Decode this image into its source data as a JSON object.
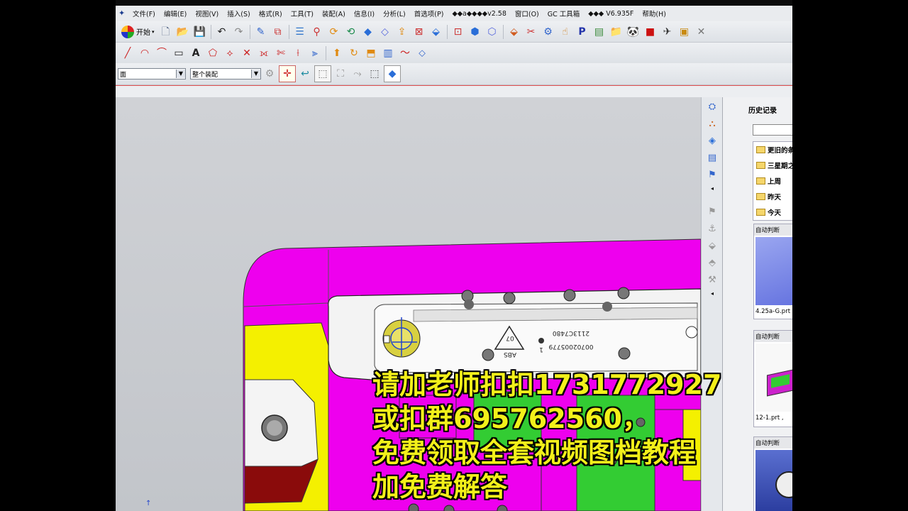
{
  "menu": {
    "items": [
      "文件(F)",
      "编辑(E)",
      "视图(V)",
      "插入(S)",
      "格式(R)",
      "工具(T)",
      "装配(A)",
      "信息(I)",
      "分析(L)",
      "首选项(P)",
      "◆◆a◆◆◆◆v2.58",
      "窗口(O)",
      "GC 工具箱",
      "◆◆◆ V6.935F",
      "帮助(H)"
    ]
  },
  "toolbar": {
    "start_label": "开始",
    "filter_value": "面",
    "scope_value": "整个装配"
  },
  "history_panel": {
    "title": "历史记录",
    "folders": [
      "更旧的条",
      "三星期之",
      "上周",
      "昨天",
      "今天"
    ],
    "thumb1": {
      "header": "自动判断",
      "label": "4.25a-G.prt"
    },
    "thumb2": {
      "header": "自动判断",
      "label": "12-1.prt ,"
    },
    "thumb3": {
      "header": "自动判断"
    }
  },
  "part_text": {
    "line1": "2113C7480",
    "line2": "00702005779",
    "num": "1",
    "recycle_code": "07",
    "material": "ABS"
  },
  "overlay": {
    "lines": [
      "请加老师扣扣1731772927",
      "或扣群695762560，",
      "免费领取全套视频图档教程",
      "加免费解答"
    ]
  },
  "colors": {
    "magenta": "#ee00ee",
    "yellow": "#f4f000",
    "green": "#33cc33",
    "overlay_text": "#f3f01a"
  }
}
